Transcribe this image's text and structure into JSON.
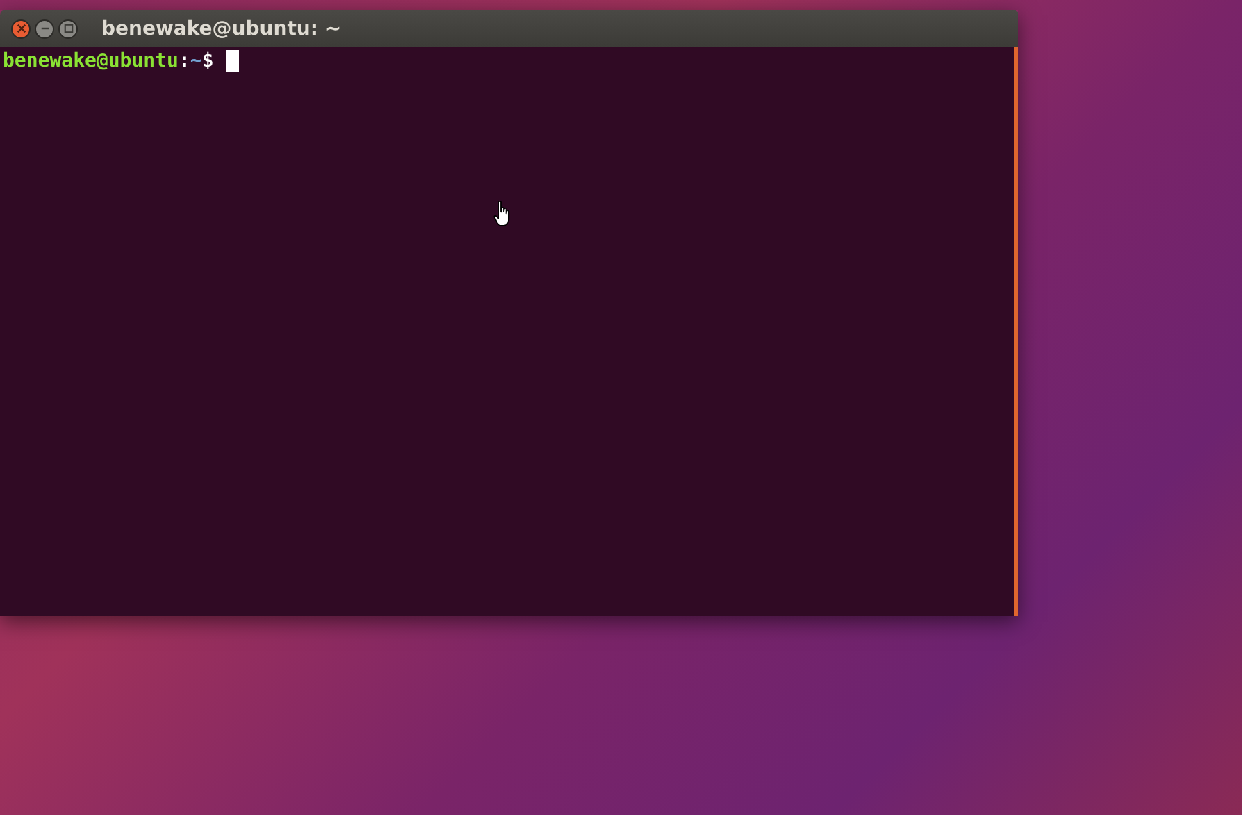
{
  "window": {
    "title": "benewake@ubuntu: ~"
  },
  "prompt": {
    "user_host": "benewake@ubuntu",
    "separator": ":",
    "path": "~",
    "symbol": "$"
  }
}
